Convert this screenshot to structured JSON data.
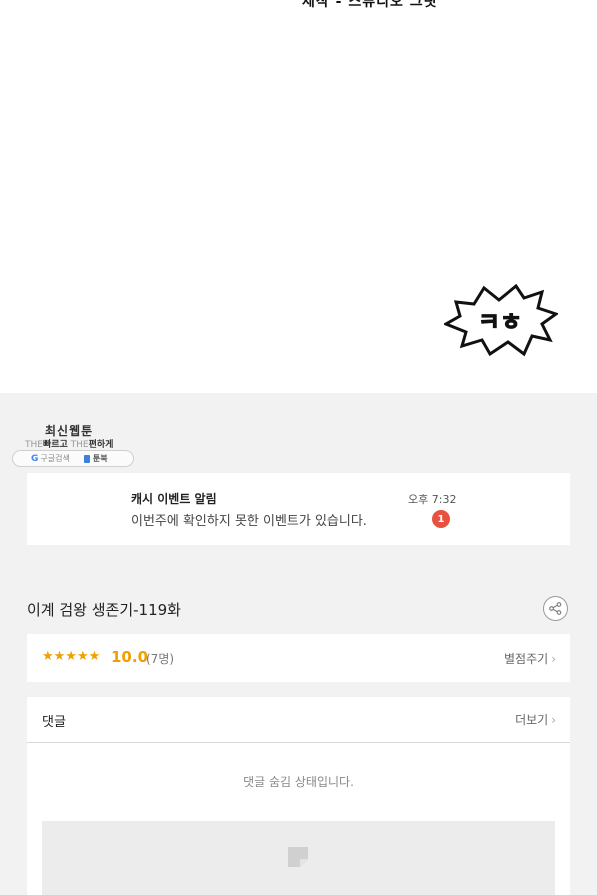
{
  "comic": {
    "credit_partial": "제작 - 스튜디오 그릿",
    "sfx_text": "ㅋㅎ"
  },
  "logo": {
    "title": "최신웹툰",
    "tag_the1": "THE",
    "tag_fast": "빠르고",
    "tag_the2": "THE",
    "tag_easy": "편하게",
    "google_mark": "G",
    "google_label": "구글검색",
    "book_label": "툰북"
  },
  "notification": {
    "title": "캐시 이벤트 알림",
    "message": "이번주에 확인하지 못한 이벤트가 있습니다.",
    "time": "오후 7:32",
    "badge_count": "1"
  },
  "episode": {
    "title": "이계 검왕 생존기-119화",
    "share_icon": "share-icon"
  },
  "rating": {
    "stars": "★★★★★",
    "score": "10.0",
    "count": "(7명)",
    "rate_label": "별점주기"
  },
  "comments": {
    "label": "댓글",
    "more_label": "더보기",
    "hidden_message": "댓글 숨김 상태입니다."
  },
  "colors": {
    "accent_star": "#f0a000",
    "badge": "#e8513f",
    "background": "#f2f2f2"
  }
}
